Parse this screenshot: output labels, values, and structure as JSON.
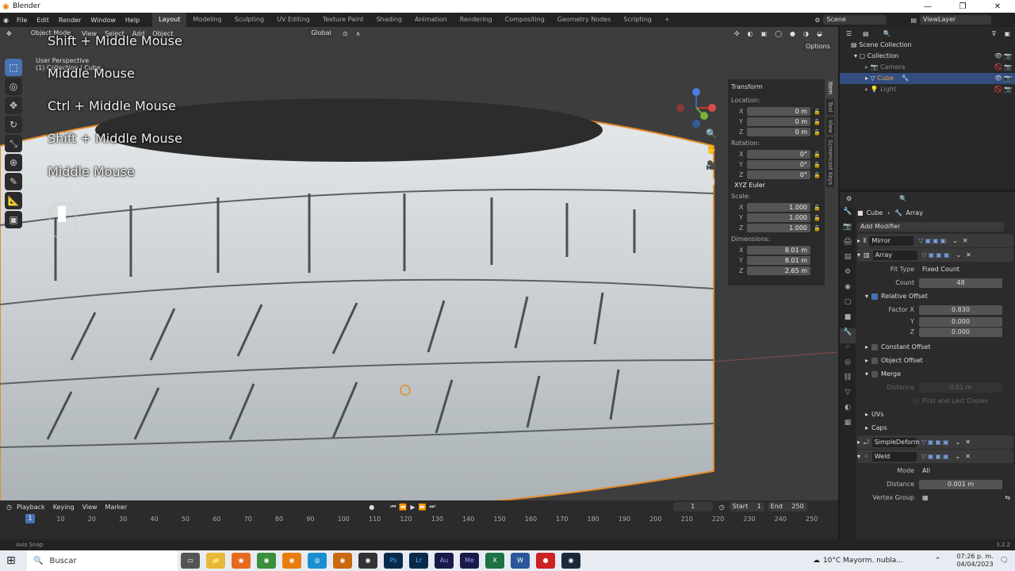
{
  "window": {
    "title": "Blender"
  },
  "topbar": {
    "menus": [
      "File",
      "Edit",
      "Render",
      "Window",
      "Help"
    ],
    "workspaces": [
      "Layout",
      "Modeling",
      "Sculpting",
      "UV Editing",
      "Texture Paint",
      "Shading",
      "Animation",
      "Rendering",
      "Compositing",
      "Geometry Nodes",
      "Scripting"
    ],
    "active_workspace": "Layout",
    "scene": "Scene",
    "view_layer": "ViewLayer"
  },
  "viewport": {
    "mode": "Object Mode",
    "menus": [
      "View",
      "Select",
      "Add",
      "Object"
    ],
    "transform_orientation": "Global",
    "options": "Options",
    "info_line1": "User Perspective",
    "info_line2": "(1) Collection | Cube",
    "overlay_keys": [
      "Shift + Middle Mouse",
      "Middle Mouse",
      "Ctrl + Middle Mouse",
      "Shift + Middle Mouse",
      "Middle Mouse"
    ]
  },
  "npanel": {
    "title": "Transform",
    "location_label": "Location:",
    "location": [
      {
        "axis": "X",
        "value": "0 m"
      },
      {
        "axis": "Y",
        "value": "0 m"
      },
      {
        "axis": "Z",
        "value": "0 m"
      }
    ],
    "rotation_label": "Rotation:",
    "rotation": [
      {
        "axis": "X",
        "value": "0°"
      },
      {
        "axis": "Y",
        "value": "0°"
      },
      {
        "axis": "Z",
        "value": "0°"
      }
    ],
    "rotation_mode": "XYZ Euler",
    "scale_label": "Scale:",
    "scale": [
      {
        "axis": "X",
        "value": "1.000"
      },
      {
        "axis": "Y",
        "value": "1.000"
      },
      {
        "axis": "Z",
        "value": "1.000"
      }
    ],
    "dimensions_label": "Dimensions:",
    "dimensions": [
      {
        "axis": "X",
        "value": "8.01 m"
      },
      {
        "axis": "Y",
        "value": "8.01 m"
      },
      {
        "axis": "Z",
        "value": "2.65 m"
      }
    ],
    "tabs": [
      "Item",
      "Tool",
      "View",
      "Screencast Keys"
    ]
  },
  "timeline": {
    "menus": [
      "Playback",
      "Keying",
      "View",
      "Marker"
    ],
    "current_frame": "1",
    "start_label": "Start",
    "start": "1",
    "end_label": "End",
    "end": "250",
    "frame_ticks": [
      "1",
      "10",
      "20",
      "30",
      "40",
      "50",
      "60",
      "70",
      "80",
      "90",
      "100",
      "110",
      "120",
      "130",
      "140",
      "150",
      "160",
      "170",
      "180",
      "190",
      "200",
      "210",
      "220",
      "230",
      "240",
      "250"
    ]
  },
  "statusbar": {
    "left": "Axis Snap",
    "version": "3.2.2"
  },
  "outliner": {
    "root": "Scene Collection",
    "collection": "Collection",
    "items": [
      "Camera",
      "Cube",
      "Light"
    ],
    "selected": "Cube"
  },
  "properties": {
    "breadcrumb_object": "Cube",
    "breadcrumb_modifier": "Array",
    "add_modifier": "Add Modifier",
    "modifiers": {
      "mirror": "Mirror",
      "array": "Array",
      "simpledeform": "SimpleDeform",
      "weld": "Weld"
    },
    "array": {
      "fit_type_label": "Fit Type",
      "fit_type": "Fixed Count",
      "count_label": "Count",
      "count": "48",
      "relative_offset": "Relative Offset",
      "factor_x_label": "Factor X",
      "factor_x": "0.830",
      "y_label": "Y",
      "y": "0.000",
      "z_label": "Z",
      "z": "0.000",
      "constant_offset": "Constant Offset",
      "object_offset": "Object Offset",
      "merge": "Merge",
      "distance_label": "Distance",
      "distance": "0.01 m",
      "first_last": "First and Last Copies",
      "uvs": "UVs",
      "caps": "Caps"
    },
    "weld": {
      "mode_label": "Mode",
      "mode": "All",
      "distance_label": "Distance",
      "distance": "0.001 m",
      "vertex_group_label": "Vertex Group"
    }
  },
  "taskbar": {
    "search": "Buscar",
    "weather": "10°C  Mayorm. nubla...",
    "time": "07:26 p. m.",
    "date": "04/04/2023"
  },
  "colors": {
    "accent": "#4772b3",
    "viewport_bg": "#3d3d3d",
    "tyre": "#d4d9db",
    "selection_outline": "#e38c2b"
  }
}
